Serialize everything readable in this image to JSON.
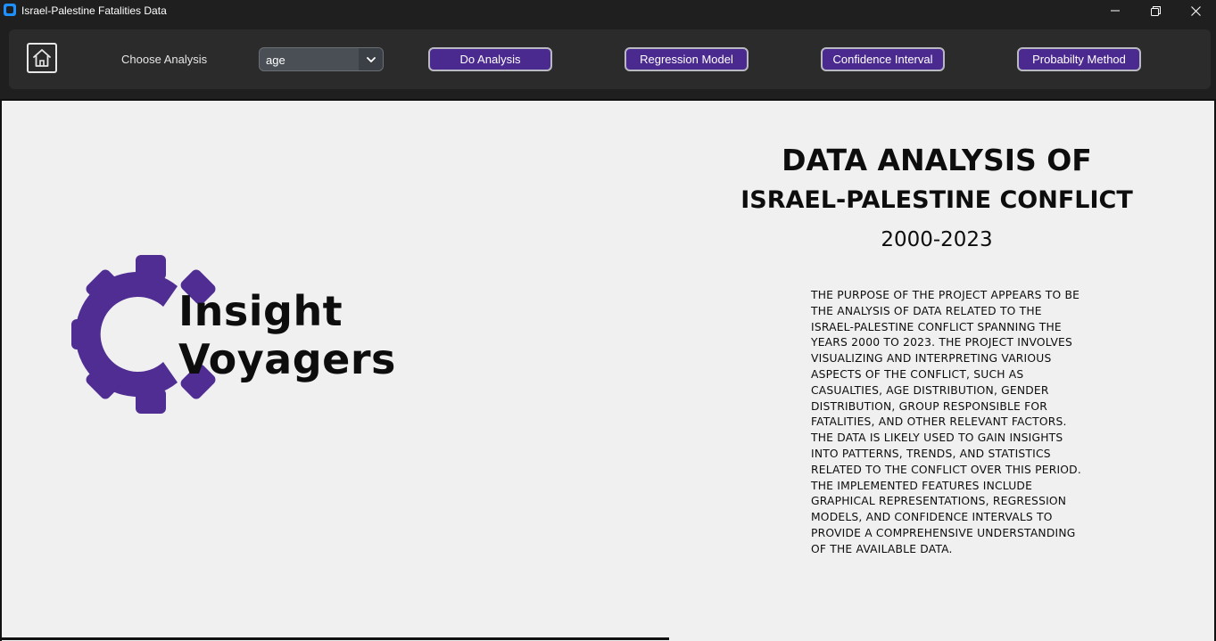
{
  "window": {
    "title": "Israel-Palestine Fatalities Data"
  },
  "toolbar": {
    "choose_label": "Choose Analysis",
    "select_value": "age",
    "buttons": {
      "do_analysis": "Do Analysis",
      "regression": "Regression Model",
      "confidence": "Confidence Interval",
      "probability": "Probabilty Method"
    }
  },
  "logo": {
    "line1": "Insight",
    "line2": "Voyagers"
  },
  "heading": {
    "line1": "DATA ANALYSIS OF",
    "line2": "ISRAEL-PALESTINE CONFLICT",
    "years": "2000-2023"
  },
  "description": [
    "THE PURPOSE OF THE PROJECT APPEARS TO BE",
    "THE ANALYSIS OF DATA RELATED TO THE",
    "ISRAEL-PALESTINE CONFLICT SPANNING THE",
    "YEARS 2000 TO 2023. THE PROJECT INVOLVES",
    "VISUALIZING AND INTERPRETING VARIOUS",
    "ASPECTS OF THE CONFLICT, SUCH AS",
    "CASUALTIES, AGE DISTRIBUTION, GENDER",
    "DISTRIBUTION, GROUP RESPONSIBLE FOR",
    "FATALITIES, AND OTHER RELEVANT FACTORS.",
    "THE DATA IS LIKELY USED TO GAIN INSIGHTS",
    "INTO PATTERNS, TRENDS, AND STATISTICS",
    "RELATED TO THE CONFLICT OVER THIS PERIOD.",
    "THE IMPLEMENTED FEATURES INCLUDE",
    "GRAPHICAL REPRESENTATIONS, REGRESSION",
    "MODELS, AND CONFIDENCE INTERVALS TO",
    "PROVIDE A COMPREHENSIVE UNDERSTANDING",
    "OF THE AVAILABLE DATA."
  ],
  "colors": {
    "accent": "#4b2a8f",
    "gear": "#4f2d93",
    "panel": "#f0f0f0",
    "toolbar": "#2b2b2b"
  },
  "icons": {
    "app": "app-icon",
    "home": "home-icon",
    "dropdown": "chevron-down-icon",
    "minimize": "minimize-icon",
    "restore": "restore-icon",
    "close": "close-icon",
    "logo": "gear-logo-icon"
  }
}
